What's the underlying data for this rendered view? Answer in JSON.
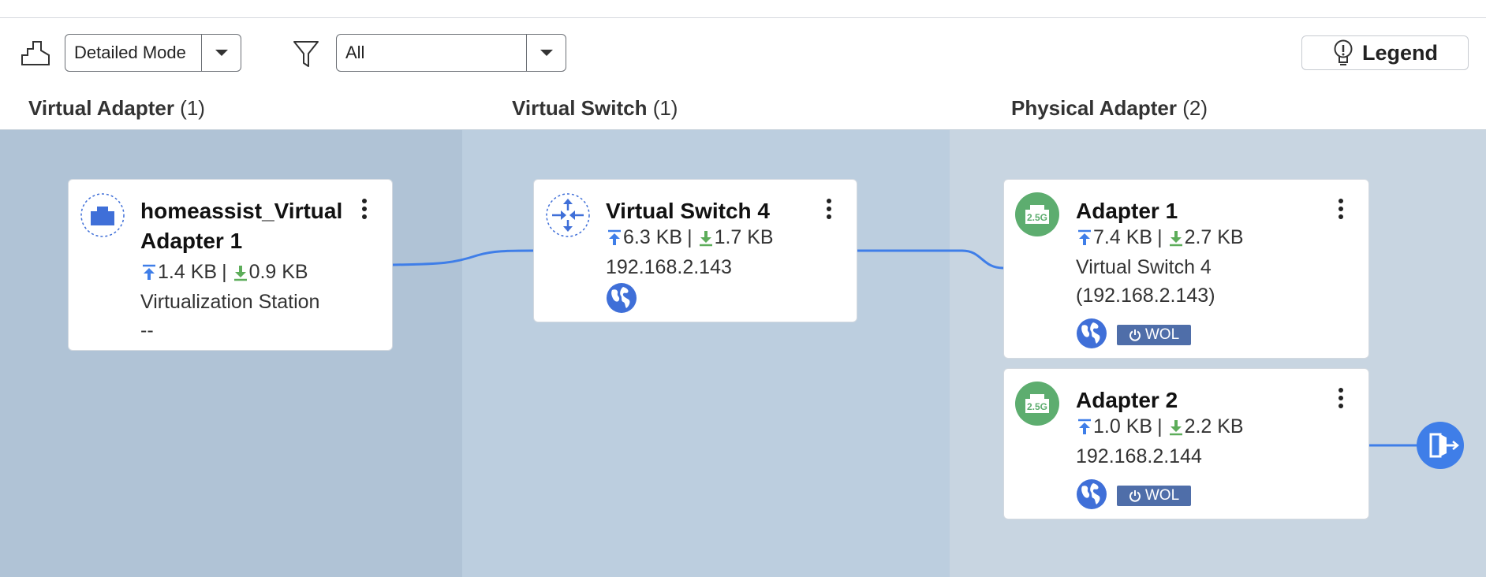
{
  "toolbar": {
    "mode_value": "Detailed Mode",
    "filter_value": "All",
    "legend_label": "Legend"
  },
  "columns": [
    {
      "title": "Virtual Adapter",
      "count": "(1)"
    },
    {
      "title": "Virtual Switch",
      "count": "(1)"
    },
    {
      "title": "Physical Adapter",
      "count": "(2)"
    }
  ],
  "virtual_adapter": {
    "title_line1": "homeassist_Virtual",
    "title_line2": "Adapter 1",
    "upload": "1.4 KB",
    "download": "0.9 KB",
    "host": "Virtualization Station",
    "ip": "--"
  },
  "virtual_switch": {
    "title": "Virtual Switch 4",
    "upload": "6.3 KB",
    "download": "1.7 KB",
    "ip": "192.168.2.143"
  },
  "physical_adapters": [
    {
      "title": "Adapter 1",
      "speed": "2.5G",
      "upload": "7.4 KB",
      "download": "2.7 KB",
      "line1": "Virtual Switch 4",
      "line2": "(192.168.2.143)",
      "wol_label": "WOL"
    },
    {
      "title": "Adapter 2",
      "speed": "2.5G",
      "upload": "1.0 KB",
      "download": "2.2 KB",
      "line1": "192.168.2.144",
      "wol_label": "WOL"
    }
  ],
  "separator": "|",
  "colors": {
    "col1_bg": "#b0c3d6",
    "col2_bg": "#bccedf",
    "col3_bg": "#c8d5e1",
    "link_line": "#3f7ee8",
    "upload_arrow": "#3f7ee8",
    "download_arrow": "#5dad5a",
    "speed_badge": "#5dad6f",
    "wol_badge": "#4f6ea9"
  },
  "icons": [
    "topology-icon",
    "chevron-down-icon",
    "filter-icon",
    "lightbulb-icon",
    "virtual-adapter-icon",
    "virtual-switch-icon",
    "ethernet-port-icon",
    "globe-icon",
    "power-icon",
    "external-port-icon",
    "more-vertical-icon",
    "upload-arrow-icon",
    "download-arrow-icon"
  ]
}
